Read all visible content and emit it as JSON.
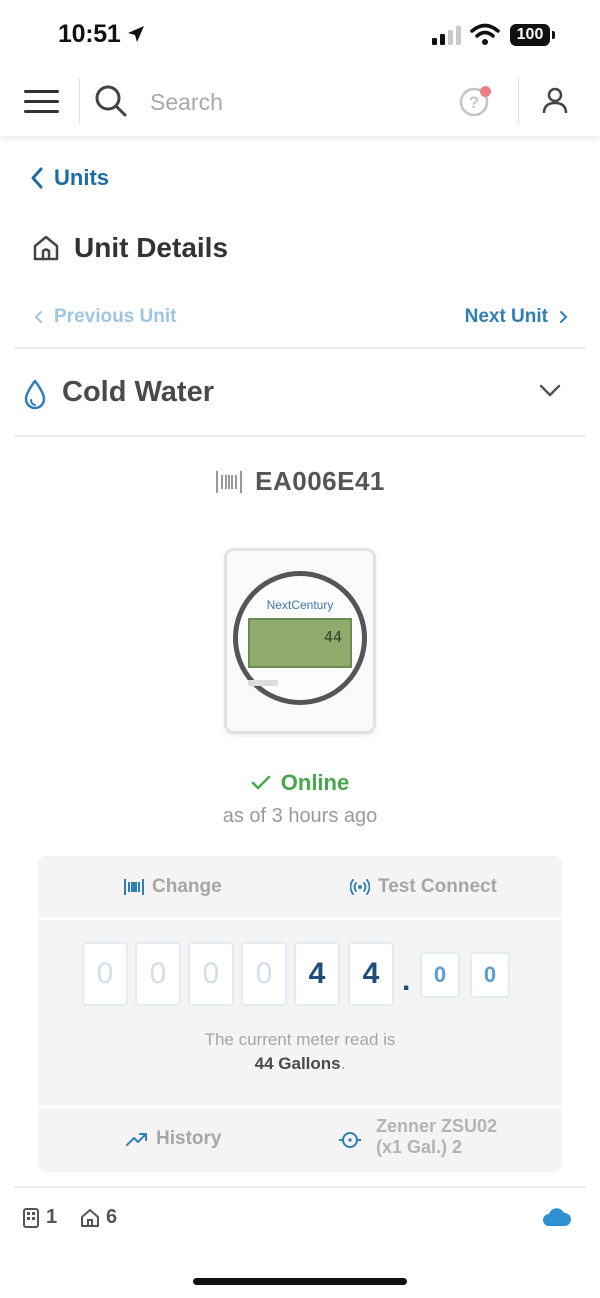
{
  "status_bar": {
    "time": "10:51",
    "battery": "100"
  },
  "topnav": {
    "search_placeholder": "Search"
  },
  "header": {
    "back_label": "Units",
    "page_title": "Unit Details",
    "prev_unit": "Previous Unit",
    "next_unit": "Next Unit"
  },
  "utility": {
    "name": "Cold Water"
  },
  "meter": {
    "id": "EA006E41",
    "brand": "NextCentury",
    "lcd_value": "44",
    "status": "Online",
    "status_time": "as of 3 hours ago",
    "status_color": "#45a84a"
  },
  "card": {
    "change_label": "Change",
    "test_connect_label": "Test Connect",
    "digits": [
      "0",
      "0",
      "0",
      "0",
      "4",
      "4"
    ],
    "decimal_digits": [
      "0",
      "0"
    ],
    "read_text": "The current meter read is",
    "read_value": "44 Gallons",
    "read_value_suffix": ".",
    "history_label": "History",
    "model_line1": "Zenner ZSU02",
    "model_line2": "(x1 Gal.) 2"
  },
  "footer": {
    "buildings_count": "1",
    "units_count": "6"
  },
  "colors": {
    "accent": "#1a6ea6",
    "online": "#45a84a",
    "cloud": "#2f8fd0"
  }
}
